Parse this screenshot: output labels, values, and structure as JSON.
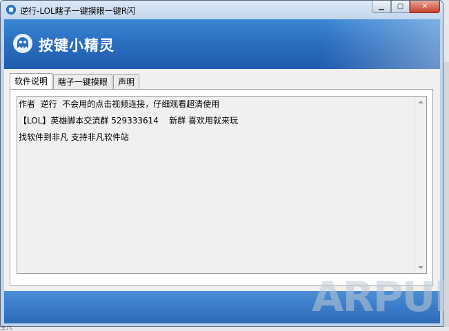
{
  "window": {
    "title": "逆行-LOL瞎子一键摸眼一键R闪",
    "icon": "app-icon"
  },
  "controls": {
    "minimize_icon": "minimize-icon",
    "maximize_icon": "maximize-icon",
    "close_icon": "close-icon"
  },
  "banner": {
    "logo_text": "按键小精灵",
    "logo_icon": "ghost-logo-icon",
    "accent": "#2b6fc0"
  },
  "tabs": [
    {
      "label": "软件说明",
      "active": true
    },
    {
      "label": "瞎子一键摸眼",
      "active": false
    },
    {
      "label": "声明",
      "active": false
    }
  ],
  "text_lines": [
    "作者  逆行  不会用的点击视频连接，仔细观看超清使用",
    "【LOL】英雄脚本交流群 529333614    新群 喜欢用就来玩",
    "找软件到非凡 支持非凡软件站"
  ],
  "watermark": "ARPUN",
  "status_fragment": "王八"
}
